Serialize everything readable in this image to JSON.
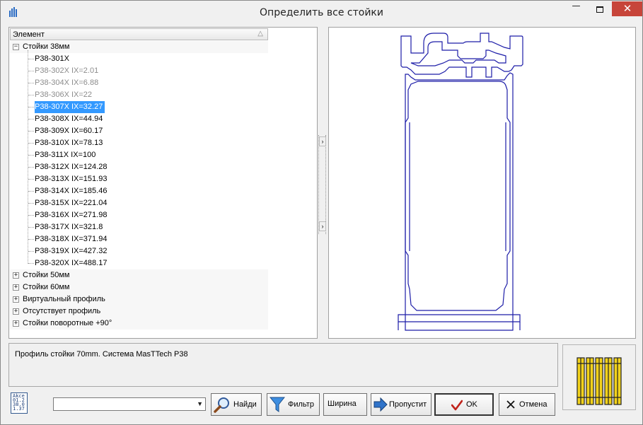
{
  "window": {
    "title": "Определить все стойки",
    "minimize_glyph": "—",
    "close_glyph": "✕"
  },
  "tree": {
    "column_header": "Элемент",
    "sort_glyph": "△",
    "categories": [
      {
        "label": "Стойки 38мм",
        "expanded": true
      },
      {
        "label": "Стойки 50мм",
        "expanded": false
      },
      {
        "label": "Стойки 60мм",
        "expanded": false
      },
      {
        "label": "Виртуальный профиль",
        "expanded": false
      },
      {
        "label": "Отсутствует профиль",
        "expanded": false
      },
      {
        "label": "Стойки поворотные +90°",
        "expanded": false
      }
    ],
    "items": [
      {
        "label": "P38-301X",
        "state": "normal"
      },
      {
        "label": "P38-302X IX=2.01",
        "state": "disabled"
      },
      {
        "label": "P38-304X IX=6.88",
        "state": "disabled"
      },
      {
        "label": "P38-306X IX=22",
        "state": "disabled"
      },
      {
        "label": "P38-307X IX=32.27",
        "state": "selected"
      },
      {
        "label": "P38-308X IX=44.94",
        "state": "normal"
      },
      {
        "label": "P38-309X IX=60.17",
        "state": "normal"
      },
      {
        "label": "P38-310X IX=78.13",
        "state": "normal"
      },
      {
        "label": "P38-311X IX=100",
        "state": "normal"
      },
      {
        "label": "P38-312X IX=124.28",
        "state": "normal"
      },
      {
        "label": "P38-313X IX=151.93",
        "state": "normal"
      },
      {
        "label": "P38-314X IX=185.46",
        "state": "normal"
      },
      {
        "label": "P38-315X IX=221.04",
        "state": "normal"
      },
      {
        "label": "P38-316X IX=271.98",
        "state": "normal"
      },
      {
        "label": "P38-317X IX=321.8",
        "state": "normal"
      },
      {
        "label": "P38-318X IX=371.94",
        "state": "normal"
      },
      {
        "label": "P38-319X IX=427.32",
        "state": "normal"
      },
      {
        "label": "P38-320X IX=488.17",
        "state": "normal"
      }
    ]
  },
  "splitter": {
    "arrow_glyph": "›"
  },
  "description": "Профиль стойки 70mm. Система MasTTech P38",
  "properties_icon": {
    "lines": [
      "Akce",
      "01.2",
      "38.0",
      "1.37"
    ]
  },
  "filter_combo": {
    "value": "",
    "arrow_glyph": "▼"
  },
  "buttons": {
    "find": "Найди",
    "filter": "Фильтр",
    "width": "Ширина",
    "skip": "Пропустит",
    "ok": "OK",
    "cancel": "Отмена"
  },
  "colors": {
    "selection": "#3399ff",
    "profile_stroke": "#1c1ca8",
    "close_button": "#c7453a",
    "grill_fill": "#f2d21c"
  }
}
